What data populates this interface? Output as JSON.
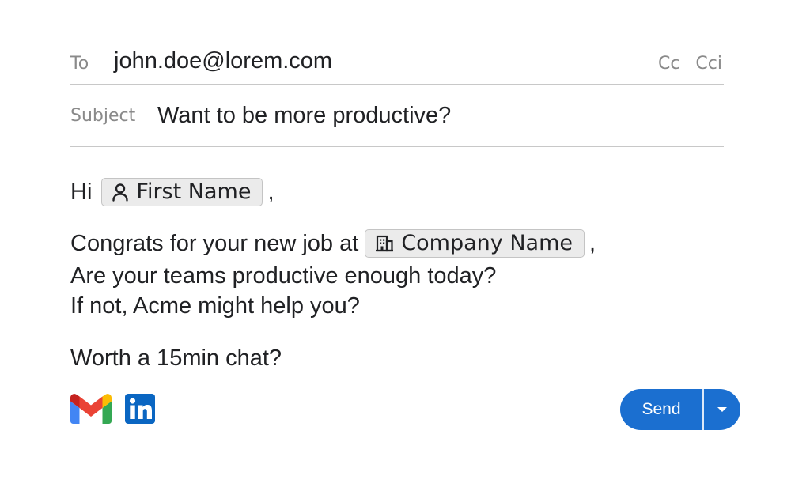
{
  "compose": {
    "to_label": "To",
    "to_value": "john.doe@lorem.com",
    "cc_label": "Cc",
    "cci_label": "Cci",
    "subject_label": "Subject",
    "subject_value": "Want to be more productive?"
  },
  "body": {
    "greeting": "Hi",
    "first_name_chip": "First Name",
    "greeting_comma": ",",
    "congrats_text": "Congrats for your new job at",
    "company_chip": "Company Name",
    "congrats_comma": ",",
    "line_teams": "Are your teams productive enough today?",
    "line_ifnot": "If not, Acme might help you?",
    "line_worth": "Worth a 15min chat?"
  },
  "footer": {
    "send_label": "Send",
    "icons": [
      "gmail-icon",
      "linkedin-icon",
      "chevron-down-icon",
      "person-icon",
      "building-icon"
    ]
  },
  "colors": {
    "send_blue": "#1b6fd0",
    "linkedin_blue": "#0a66c2",
    "label_gray": "#8a8a8a",
    "chip_bg": "#ebebeb"
  }
}
